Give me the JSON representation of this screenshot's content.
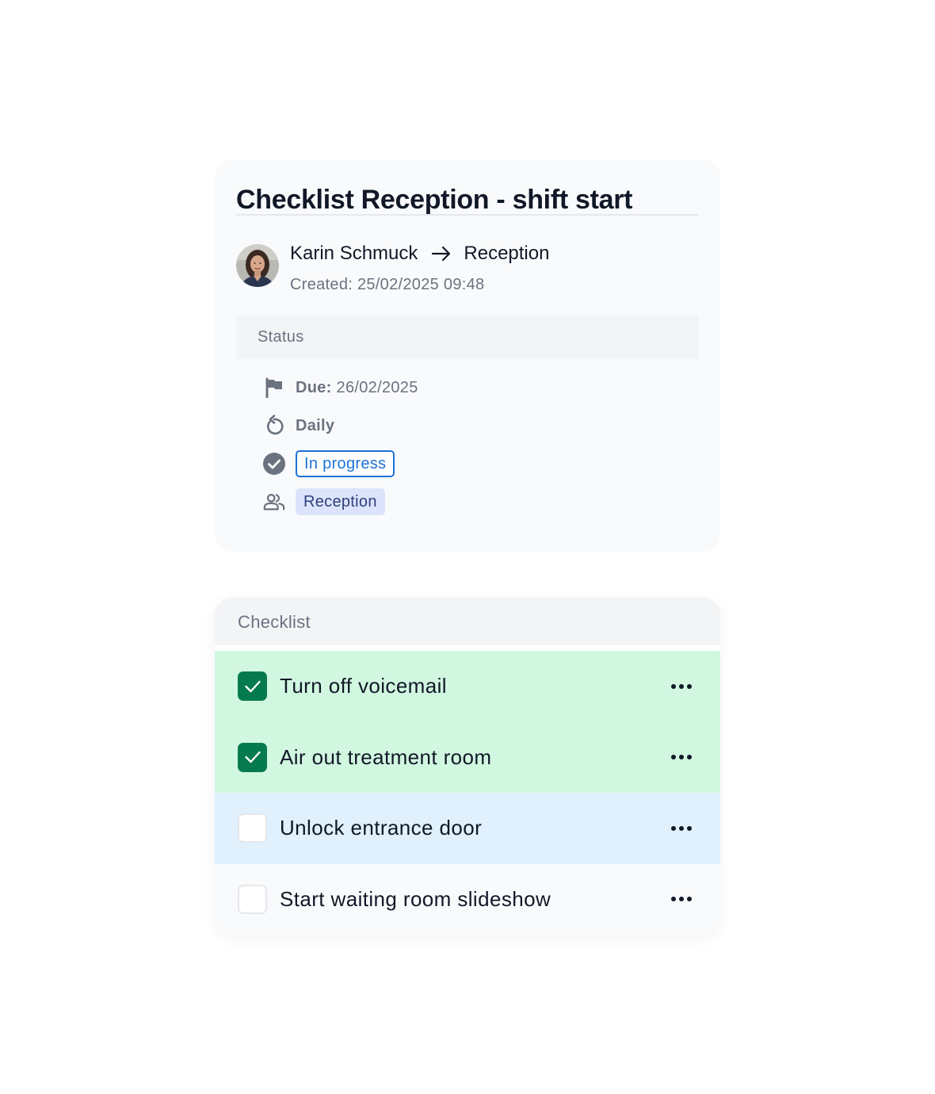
{
  "task": {
    "title": "Checklist Reception - shift start",
    "assignee": "Karin Schmuck",
    "target": "Reception",
    "created": "Created: 25/02/2025 09:48",
    "status_header": "Status",
    "due_label": "Due:",
    "due_value": "26/02/2025",
    "recurrence": "Daily",
    "state": "In progress",
    "team": "Reception",
    "icons": {
      "due": "flag-icon",
      "recurrence": "repeat-icon",
      "state": "check-circle-icon",
      "team": "people-icon",
      "arrow": "arrow-right-icon"
    }
  },
  "checklist": {
    "header": "Checklist",
    "items": [
      {
        "label": "Turn off voicemail",
        "checked": true,
        "state": "done"
      },
      {
        "label": "Air out treatment room",
        "checked": true,
        "state": "done"
      },
      {
        "label": "Unlock entrance door",
        "checked": false,
        "state": "active"
      },
      {
        "label": "Start waiting room slideshow",
        "checked": false,
        "state": "idle"
      }
    ]
  },
  "colors": {
    "done_row": "#d1f7e0",
    "active_row": "#e0f0fd",
    "checkbox_checked": "#057a4e",
    "progress_badge": "#1d72d6",
    "team_badge_bg": "#dbe4fb"
  }
}
